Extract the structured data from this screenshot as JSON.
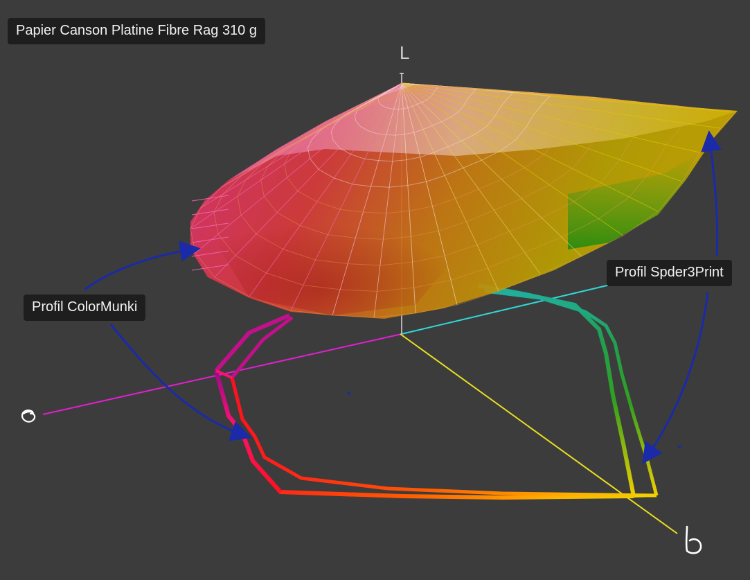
{
  "title": "Papier Canson Platine Fibre Rag 310 g",
  "axes": {
    "l_label": "L",
    "a_label": "a",
    "b_label": "b"
  },
  "profiles": [
    {
      "name": "Profil ColorMunki"
    },
    {
      "name": "Profil Spder3Print"
    }
  ],
  "colors": {
    "background": "#3d3c3c",
    "label_background": "#1e1e1e",
    "label_text": "#f2f2f2",
    "arrow": "#1f2f9a",
    "a_axis": "#e020d0",
    "b_axis": "#e8e020",
    "cyan_axis": "#30d8d8"
  }
}
